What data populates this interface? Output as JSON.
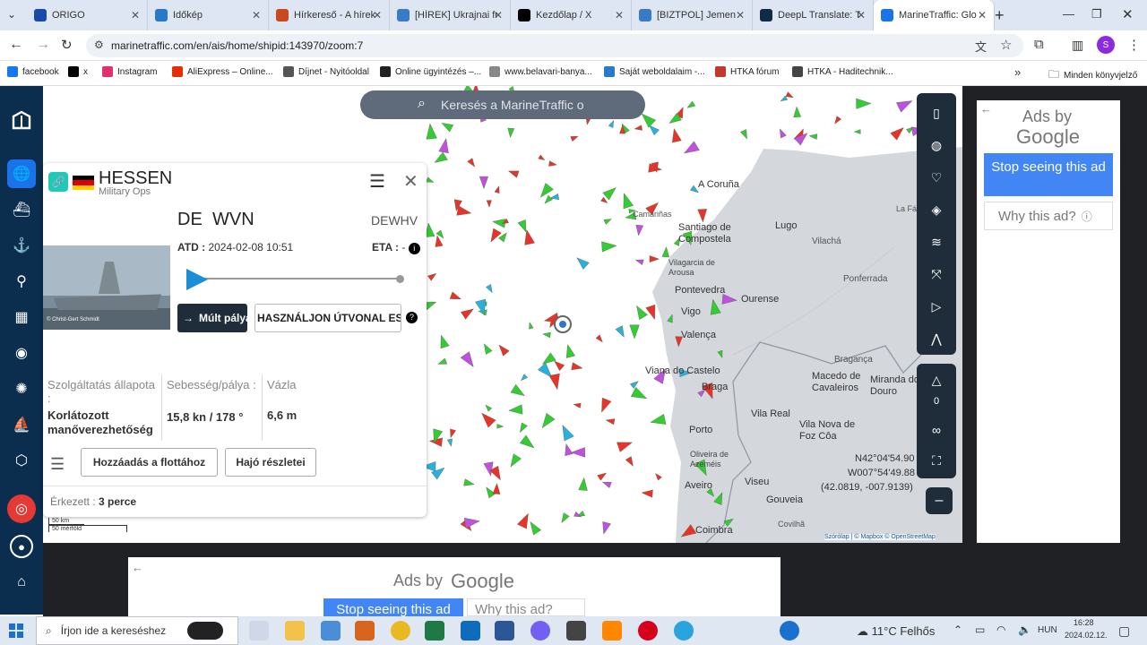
{
  "tabs": [
    {
      "label": "ORIGO",
      "icon": "origo-icon",
      "color": "#1a4aa8"
    },
    {
      "label": "Időkép",
      "icon": "cloud-icon",
      "color": "#2a79c9"
    },
    {
      "label": "Hírkereső - A hírek",
      "icon": "hirkereso-icon",
      "color": "#c8491f"
    },
    {
      "label": "[HÍREK] Ukrajnai fr",
      "icon": "forum-icon",
      "color": "#3a7bc8"
    },
    {
      "label": "Kezdőlap / X",
      "icon": "x-icon",
      "color": "#000000"
    },
    {
      "label": "[BIZTPOL] Jemen",
      "icon": "forum-icon",
      "color": "#3a7bc8"
    },
    {
      "label": "DeepL Translate: T",
      "icon": "deepl-icon",
      "color": "#0f2b46"
    },
    {
      "label": "MarineTraffic: Glo",
      "icon": "marinetraffic-icon",
      "color": "#1a73e8"
    }
  ],
  "new_tab": "+",
  "url": "marinetraffic.com/en/ais/home/shipid:143970/zoom:7",
  "profile_initial": "S",
  "bookmarks": [
    {
      "label": "facebook",
      "color": "#1877f2"
    },
    {
      "label": "x",
      "color": "#000000"
    },
    {
      "label": "Instagram",
      "color": "#e1306c"
    },
    {
      "label": "AliExpress – Online...",
      "color": "#e62e04"
    },
    {
      "label": "Díjnet - Nyitóoldal",
      "color": "#555555"
    },
    {
      "label": "Online ügyintézés –...",
      "color": "#222222"
    },
    {
      "label": "www.belavari-banya...",
      "color": "#888888"
    },
    {
      "label": "Saját weboldalaim -...",
      "color": "#2a79c9"
    },
    {
      "label": "HTKA fórum",
      "color": "#c0392b"
    },
    {
      "label": "HTKA - Haditechnik...",
      "color": "#444444"
    }
  ],
  "bookmarks_more": "»",
  "all_bookmarks": "Minden könyvjelző",
  "map": {
    "search_placeholder": "Keresés a MarineTraffic o",
    "places": [
      "A Coruña",
      "Lugo",
      "Santiago de Compostela",
      "Vilagarcia de Arousa",
      "Pontevedra",
      "Ourense",
      "Vigo",
      "Valença",
      "Viana do Castelo",
      "Braga",
      "Vila Real",
      "Porto",
      "Oliveira de Azeméis",
      "Aveiro",
      "Viseu",
      "Gouveia",
      "Coimbra",
      "Vilachá",
      "Ponferrada",
      "Bragança",
      "Macedo de Cavaleiros",
      "Miranda do Douro",
      "Vila Nova de Foz Côa",
      "Camariñas",
      "La Fá",
      "Covilhã"
    ],
    "coords": [
      "N42°04'54.90",
      "W007°54'49.88",
      "(42.0819, -007.9139)"
    ],
    "attribution": "Szórólap | © Mapbox © OpenStreetMap",
    "scale": [
      "50 km",
      "50 mérföld"
    ],
    "zoom_counter": "0"
  },
  "vessel": {
    "name": "HESSEN",
    "type": "Military Ops",
    "flag_code": "DE",
    "callsign": "WVN",
    "dest_code": "DEWHV",
    "atd_label": "ATD :",
    "atd_value": "2024-02-08 10:51",
    "eta_label": "ETA :",
    "eta_value": "-",
    "progress": 0,
    "past_track_button": "Múlt pálya",
    "route_tool_button": "HASZNÁLJON ÚTVONAL ESZKÖZT",
    "status_label": "Szolgáltatás állapota :",
    "status_value": "Korlátozott manőverezhetőség",
    "speed_label": "Sebesség/pálya :",
    "speed_value": "15,8 kn / 178 °",
    "draught_label": "Vázla",
    "draught_value": "6,6 m",
    "add_fleet_button": "Hozzáadás a flottához",
    "details_button": "Hajó részletei",
    "received_label": "Érkezett :",
    "received_value": "3 perce",
    "photo_credit": "© Christ-Gert Schmidt"
  },
  "ads": {
    "ads_by": "Ads by",
    "google": "Google",
    "stop": "Stop seeing this ad",
    "why": "Why this ad?"
  },
  "taskbar": {
    "search_placeholder": "Írjon ide a kereséshez",
    "weather": "11°C  Felhős",
    "lang": "HUN",
    "time": "16:28",
    "date": "2024.02.12."
  }
}
